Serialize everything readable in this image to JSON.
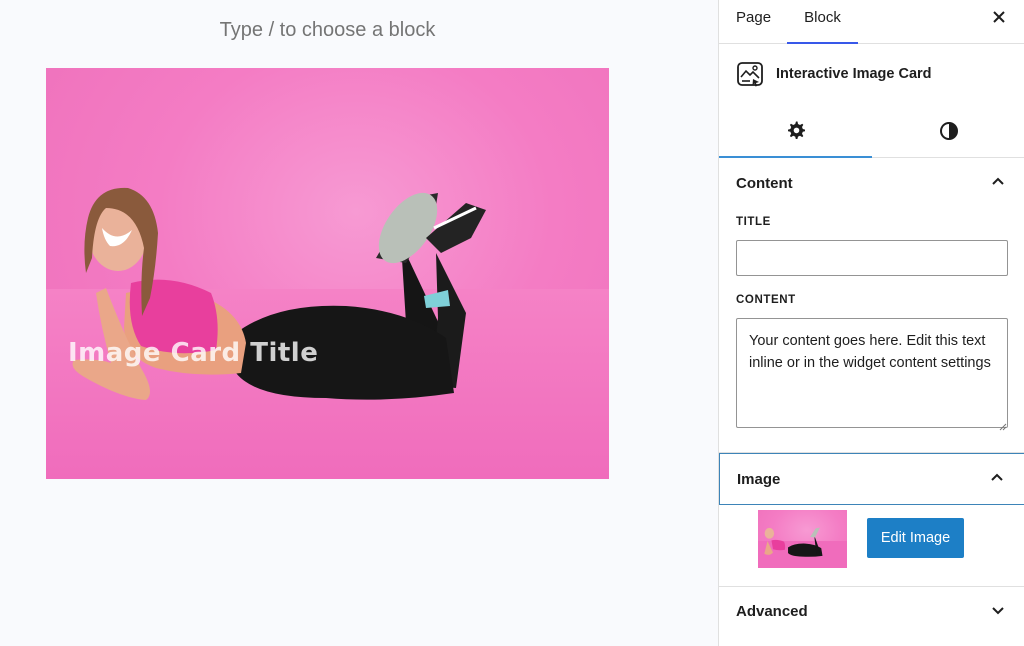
{
  "editor": {
    "block_prompt": "Type / to choose a block",
    "card_title": "Image Card Title"
  },
  "sidebar": {
    "tabs": [
      {
        "label": "Page"
      },
      {
        "label": "Block",
        "active": true
      }
    ],
    "close_icon": "close-icon",
    "block": {
      "icon": "interactive-image-card-icon",
      "title": "Interactive Image Card"
    },
    "subtabs": [
      {
        "icon": "gear-icon",
        "active": true
      },
      {
        "icon": "contrast-icon"
      }
    ],
    "content_panel": {
      "title": "Content",
      "title_label": "TITLE",
      "title_value": "",
      "content_label": "CONTENT",
      "content_value": "Your content goes here. Edit this text inline or in the widget content settings"
    },
    "image_panel": {
      "title": "Image",
      "edit_button": "Edit Image"
    },
    "advanced_panel": {
      "title": "Advanced"
    }
  },
  "colors": {
    "accent": "#3858e9",
    "button": "#1d7fc6",
    "image_background": "#f47cc4"
  }
}
